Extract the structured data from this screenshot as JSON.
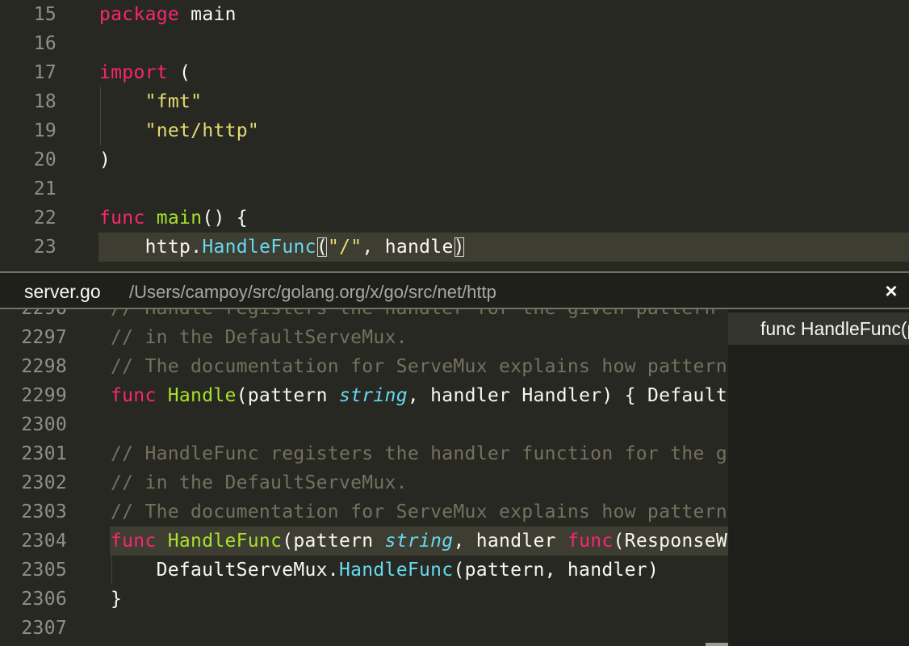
{
  "editor": {
    "lines": [
      {
        "num": "15",
        "tokens": [
          {
            "t": "package",
            "c": "kw"
          },
          {
            "t": " main",
            "c": ""
          }
        ]
      },
      {
        "num": "16",
        "tokens": []
      },
      {
        "num": "17",
        "tokens": [
          {
            "t": "import",
            "c": "kw"
          },
          {
            "t": " (",
            "c": ""
          }
        ]
      },
      {
        "num": "18",
        "tokens": [
          {
            "t": "    ",
            "c": ""
          },
          {
            "t": "\"fmt\"",
            "c": "str"
          }
        ]
      },
      {
        "num": "19",
        "tokens": [
          {
            "t": "    ",
            "c": ""
          },
          {
            "t": "\"net/http\"",
            "c": "str"
          }
        ]
      },
      {
        "num": "20",
        "tokens": [
          {
            "t": ")",
            "c": ""
          }
        ]
      },
      {
        "num": "21",
        "tokens": []
      },
      {
        "num": "22",
        "tokens": [
          {
            "t": "func",
            "c": "kw"
          },
          {
            "t": " ",
            "c": ""
          },
          {
            "t": "main",
            "c": "fn"
          },
          {
            "t": "() {",
            "c": ""
          }
        ]
      },
      {
        "num": "23",
        "highlight": true,
        "tokens": [
          {
            "t": "    http.",
            "c": ""
          },
          {
            "t": "HandleFunc",
            "c": "call"
          },
          {
            "t": "(",
            "c": "bracket"
          },
          {
            "t": "\"/\"",
            "c": "str"
          },
          {
            "t": ", handle",
            "c": ""
          },
          {
            "t": ")",
            "c": "bracket"
          }
        ]
      }
    ]
  },
  "peek": {
    "file_name": "server.go",
    "path": "/Users/campoy/src/golang.org/x/go/src/net/http",
    "close_icon": "×",
    "reference": "func HandleFunc(pattern string, handler func(ResponseWriter, *Request))",
    "lines": [
      {
        "num": "2296",
        "tokens": [
          {
            "t": "// Handle registers the handler for the given pattern",
            "c": "cm"
          }
        ]
      },
      {
        "num": "2297",
        "tokens": [
          {
            "t": "// in the DefaultServeMux.",
            "c": "cm"
          }
        ]
      },
      {
        "num": "2298",
        "tokens": [
          {
            "t": "// The documentation for ServeMux explains how patterns are matched.",
            "c": "cm"
          }
        ]
      },
      {
        "num": "2299",
        "tokens": [
          {
            "t": "func",
            "c": "kw"
          },
          {
            "t": " ",
            "c": ""
          },
          {
            "t": "Handle",
            "c": "fn"
          },
          {
            "t": "(pattern ",
            "c": ""
          },
          {
            "t": "string",
            "c": "type"
          },
          {
            "t": ", handler Handler) { DefaultServeMux.Handle(pattern, handler) }",
            "c": ""
          }
        ]
      },
      {
        "num": "2300",
        "tokens": []
      },
      {
        "num": "2301",
        "tokens": [
          {
            "t": "// HandleFunc registers the handler function for the given pattern",
            "c": "cm"
          }
        ]
      },
      {
        "num": "2302",
        "tokens": [
          {
            "t": "// in the DefaultServeMux.",
            "c": "cm"
          }
        ]
      },
      {
        "num": "2303",
        "tokens": [
          {
            "t": "// The documentation for ServeMux explains how patterns are matched.",
            "c": "cm"
          }
        ]
      },
      {
        "num": "2304",
        "highlight": true,
        "tokens": [
          {
            "t": "func",
            "c": "kw"
          },
          {
            "t": " ",
            "c": ""
          },
          {
            "t": "HandleFunc",
            "c": "fn"
          },
          {
            "t": "(pattern ",
            "c": ""
          },
          {
            "t": "string",
            "c": "type"
          },
          {
            "t": ", handler ",
            "c": ""
          },
          {
            "t": "func",
            "c": "kw"
          },
          {
            "t": "(ResponseWriter, *Request)) {",
            "c": ""
          }
        ]
      },
      {
        "num": "2305",
        "tokens": [
          {
            "t": "    DefaultServeMux.",
            "c": ""
          },
          {
            "t": "HandleFunc",
            "c": "call"
          },
          {
            "t": "(pattern, handler)",
            "c": ""
          }
        ]
      },
      {
        "num": "2306",
        "tokens": [
          {
            "t": "}",
            "c": ""
          }
        ]
      },
      {
        "num": "2307",
        "tokens": []
      }
    ]
  },
  "colors": {
    "background": "#272822",
    "keyword": "#f92672",
    "function": "#a6e22e",
    "string": "#e6db74",
    "call": "#66d9ef",
    "comment": "#75715e"
  }
}
